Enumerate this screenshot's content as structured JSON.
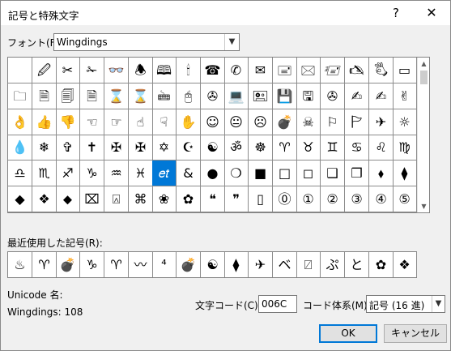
{
  "dialog": {
    "title": "記号と特殊文字",
    "help_label": "?",
    "close_label": "✕"
  },
  "font": {
    "label": "フォント(F):",
    "value": "Wingdings",
    "arrow_icon": "chevron-down-icon"
  },
  "grid": {
    "selected_index": 74,
    "symbols": [
      " ",
      "🖉",
      "✂",
      "✁",
      "👓",
      "🕭",
      "🕮",
      "🕯",
      "☎",
      "✆",
      "✉",
      "🖃",
      "🖂",
      "🖅",
      "🖎",
      "🖏",
      "▭",
      "🗀",
      "🗎",
      "🗐",
      "🗎",
      "⌛",
      "⌛",
      "🖮",
      "🖰",
      "✇",
      "💻",
      "🖭",
      "💾",
      "🖫",
      "✇",
      "✍",
      "✍",
      "✌",
      "👌",
      "👍",
      "👎",
      "☜",
      "☞",
      "☝",
      "☟",
      "✋",
      "☺",
      "😐",
      "☹",
      "💣",
      "☠",
      "⚐",
      "🏱",
      "✈",
      "☼",
      "💧",
      "❄",
      "✞",
      "✝",
      "✠",
      "✠",
      "✡",
      "☪",
      "☯",
      "ॐ",
      "☸",
      "♈",
      "♉",
      "♊",
      "♋",
      "♌",
      "♍",
      "♎",
      "♏",
      "♐",
      "♑",
      "♒",
      "♓",
      "𝑒𝑡",
      "&",
      "●",
      "❍",
      "■",
      "□",
      "◻",
      "❑",
      "❒",
      "⬧",
      "⧫",
      "◆",
      "❖",
      "⬥",
      "⌧",
      "⍓",
      "⌘",
      "❀",
      "✿",
      "❝",
      "❞",
      "▯",
      "⓪",
      "①",
      "②",
      "③",
      "④",
      "⑤"
    ]
  },
  "scrollbar": {
    "up_icon": "▲",
    "down_icon": "▼"
  },
  "recent": {
    "label": "最近使用した記号(R):",
    "symbols": [
      "♨",
      "♈",
      "💣",
      "♑",
      "♈",
      "〰",
      "⁴",
      "💣",
      "☯",
      "⧫",
      "✈",
      "ベ",
      "⍁",
      "ぷ",
      "と",
      "✿",
      "❖"
    ]
  },
  "info": {
    "unicode_name_label": "Unicode 名:",
    "char_name": "Wingdings: 108"
  },
  "code": {
    "label": "文字コード(C):",
    "value": "006C",
    "system_label": "コード体系(M):",
    "system_value": "記号 (16 進)"
  },
  "buttons": {
    "ok": "OK",
    "cancel": "キャンセル"
  }
}
